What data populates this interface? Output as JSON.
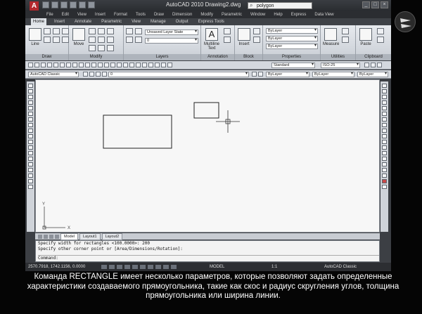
{
  "window": {
    "title": "AutoCAD 2010    Drawing2.dwg",
    "search_value": "polygon"
  },
  "menu": [
    "File",
    "Edit",
    "View",
    "Insert",
    "Format",
    "Tools",
    "Draw",
    "Dimension",
    "Modify",
    "Parametric",
    "Window",
    "Help",
    "Express",
    "Data View"
  ],
  "ribbon_tabs": [
    "Home",
    "Insert",
    "Annotate",
    "Parametric",
    "View",
    "Manage",
    "Output",
    "Express Tools"
  ],
  "ribbon": {
    "line_label": "Line",
    "move_label": "Move",
    "text_label": "Multiline Text",
    "insert_label": "Insert",
    "measure_label": "Measure",
    "paste_label": "Paste",
    "layer_state": "Unsaved Layer State",
    "layer_value": "0",
    "bylayer_1": "ByLayer",
    "bylayer_2": "ByLayer",
    "bylayer_3": "ByLayer",
    "panels": [
      "Draw",
      "Modify",
      "Layers",
      "Annotation",
      "Block",
      "Properties",
      "Utilities",
      "Clipboard"
    ]
  },
  "toolbars": {
    "text_style": "Standard",
    "dim_style": "ISO-25",
    "workspace": "AutoCAD Classic",
    "layer": "0",
    "color": "ByLayer",
    "linetype": "ByLayer",
    "lineweight": "ByLayer"
  },
  "layout_tabs": [
    "Model",
    "Layout1",
    "Layout2"
  ],
  "command_lines": [
    "Specify width for rectangles <100.0000>: 200",
    "Specify other corner point or [Area/Dimensions/Rotation]:"
  ],
  "command_prompt": "Command:",
  "status": {
    "coords": "2570.7918, 1742.1156, 0.0000",
    "model": "MODEL",
    "scale": "1:1",
    "workspace": "AutoCAD Classic"
  },
  "caption": "Команда RECTANGLE имеет несколько параметров, которые позволяют задать определенные характеристики создаваемого прямоугольника, такие как скос и радиус скругления углов, толщина прямоугольника или ширина линии."
}
